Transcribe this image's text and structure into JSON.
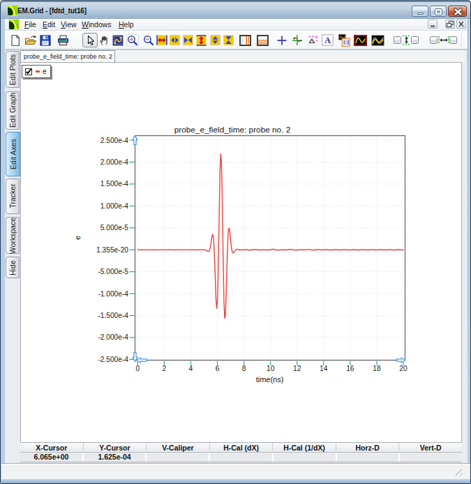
{
  "window": {
    "title": "EM.Grid - [fdtd_tut16]",
    "logo_icon": "emgrid-green-swoosh",
    "controls": [
      "minimize",
      "maximize",
      "close"
    ]
  },
  "menu": {
    "items": [
      {
        "label": "File",
        "accel": "F"
      },
      {
        "label": "Edit",
        "accel": "E"
      },
      {
        "label": "View",
        "accel": "V"
      },
      {
        "label": "Windows",
        "accel": "W"
      },
      {
        "label": "Help",
        "accel": "H"
      }
    ],
    "mdi_controls": [
      "minimize",
      "restore",
      "close"
    ]
  },
  "toolbar": {
    "buttons": [
      {
        "name": "new"
      },
      {
        "name": "open"
      },
      {
        "name": "save"
      },
      {
        "name": "print"
      },
      {
        "name": "select-cursor",
        "active": true
      },
      {
        "name": "pan"
      },
      {
        "name": "fit-to-window"
      },
      {
        "name": "zoom-in"
      },
      {
        "name": "zoom-out"
      },
      {
        "name": "expand-x"
      },
      {
        "name": "stretch-x"
      },
      {
        "name": "compress-x"
      },
      {
        "name": "expand-y"
      },
      {
        "name": "stretch-y"
      },
      {
        "name": "compress-y"
      },
      {
        "name": "vertical-caliper"
      },
      {
        "name": "horizontal-caliper"
      },
      {
        "name": "crosshair-cursor"
      },
      {
        "name": "tracker"
      },
      {
        "name": "slope-caliper"
      },
      {
        "name": "add-text"
      },
      {
        "name": "copy-plot-data"
      },
      {
        "name": "plot-style-boxed"
      },
      {
        "name": "plot-style-plain"
      },
      {
        "name": "sync-y-box-left"
      },
      {
        "name": "sync-y-axes"
      },
      {
        "name": "sync-y-box-right"
      },
      {
        "name": "sync-x-box-left"
      },
      {
        "name": "sync-x-axes"
      },
      {
        "name": "sync-x-box-right"
      }
    ]
  },
  "document_tab": {
    "label": "probe_e_field_time: probe no. 2"
  },
  "sidebar": {
    "tabs": [
      {
        "label": "Edit Plots"
      },
      {
        "label": "Edit Graph"
      },
      {
        "label": "Edit Axes",
        "active": true
      },
      {
        "label": "Tracker"
      },
      {
        "label": "Workspace"
      },
      {
        "label": "Hide"
      }
    ]
  },
  "legend": {
    "series_label": "e",
    "checked": true,
    "line_color": "#f13f3b"
  },
  "chart_data": {
    "type": "line",
    "title": "probe_e_field_time: probe no. 2",
    "xlabel": "time(ns)",
    "ylabel": "e",
    "xlim": [
      0,
      20
    ],
    "ylim": [
      -0.00025,
      0.00025
    ],
    "grid": true,
    "legend_position": "top-left",
    "xticks": [
      0,
      2,
      4,
      6,
      8,
      10,
      12,
      14,
      16,
      18,
      20
    ],
    "yticks": [
      {
        "label": "2.500e-4",
        "value": 0.00025
      },
      {
        "label": "2.000e-4",
        "value": 0.0002
      },
      {
        "label": "1.500e-4",
        "value": 0.00015
      },
      {
        "label": "1.000e-4",
        "value": 0.0001
      },
      {
        "label": "5.000e-5",
        "value": 5e-05
      },
      {
        "label": "1.355e-20",
        "value": 1.355e-20
      },
      {
        "label": "-5.000e-5",
        "value": -5e-05
      },
      {
        "label": "-1.000e-4",
        "value": -0.0001
      },
      {
        "label": "-1.500e-4",
        "value": -0.00015
      },
      {
        "label": "-2.000e-4",
        "value": -0.0002
      },
      {
        "label": "-2.500e-4",
        "value": -0.00025
      }
    ],
    "y_scale": 0.0001,
    "y_unit_note": "series y values are in units of y_scale (1e-4)",
    "series": [
      {
        "name": "e",
        "color": "#f13f3b",
        "x": [
          0.0,
          0.05,
          0.1,
          0.15,
          0.2,
          0.25,
          0.3,
          0.35,
          0.4,
          0.45,
          0.5,
          0.55,
          0.6,
          0.65,
          0.7,
          0.75,
          0.8,
          0.85,
          0.9,
          0.95,
          1.0,
          1.05,
          1.1,
          1.15,
          1.2,
          1.25,
          1.3,
          1.35,
          1.4,
          1.45,
          1.5,
          1.55,
          1.6,
          1.65,
          1.7,
          1.75,
          1.8,
          1.85,
          1.9,
          1.95,
          2.0,
          2.05,
          2.1,
          2.15,
          2.2,
          2.25,
          2.3,
          2.35,
          2.4,
          2.45,
          2.5,
          2.55,
          2.6,
          2.65,
          2.7,
          2.75,
          2.8,
          2.85,
          2.9,
          2.95,
          3.0,
          3.05,
          3.1,
          3.15,
          3.2,
          3.25,
          3.3,
          3.35,
          3.4,
          3.45,
          3.5,
          3.55,
          3.6,
          3.65,
          3.7,
          3.75,
          3.8,
          3.85,
          3.9,
          3.95,
          4.0,
          4.05,
          4.1,
          4.15,
          4.2,
          4.25,
          4.3,
          4.35,
          4.4,
          4.45,
          4.5,
          4.55,
          4.6,
          4.65,
          4.7,
          4.75,
          4.8,
          4.85,
          4.9,
          4.95,
          5.0,
          5.05,
          5.1,
          5.15,
          5.2,
          5.25,
          5.3,
          5.35,
          5.4,
          5.45,
          5.5,
          5.55,
          5.6,
          5.65,
          5.7,
          5.75,
          5.8,
          5.85,
          5.9,
          5.95,
          6.0,
          6.05,
          6.1,
          6.15,
          6.2,
          6.25,
          6.3,
          6.35,
          6.4,
          6.45,
          6.5,
          6.55,
          6.6,
          6.65,
          6.7,
          6.75,
          6.8,
          6.85,
          6.9,
          6.95,
          7.0,
          7.05,
          7.1,
          7.15,
          7.2,
          7.25,
          7.3,
          7.35,
          7.4,
          7.45,
          7.5,
          7.55,
          7.6,
          7.65,
          7.7,
          7.75,
          7.8,
          7.85,
          7.9,
          7.95,
          8.0,
          8.05,
          8.1,
          8.15,
          8.2,
          8.25,
          8.3,
          8.35,
          8.4,
          8.45,
          8.5,
          8.55,
          8.6,
          8.65,
          8.7,
          8.75,
          8.8,
          8.85,
          8.9,
          8.95,
          9.0,
          9.05,
          9.1,
          9.15,
          9.2,
          9.25,
          9.3,
          9.35,
          9.4,
          9.45,
          9.5,
          9.55,
          9.6,
          9.65,
          9.7,
          9.75,
          9.8,
          9.85,
          9.9,
          9.95,
          10.0,
          10.05,
          10.1,
          10.15,
          10.2,
          10.25,
          10.3,
          10.35,
          10.4,
          10.45,
          10.5,
          10.55,
          10.6,
          10.65,
          10.7,
          10.75,
          10.8,
          10.85,
          10.9,
          10.95,
          11.0,
          11.05,
          11.1,
          11.15,
          11.2,
          11.25,
          11.3,
          11.35,
          11.4,
          11.45,
          11.5,
          11.55,
          11.6,
          11.65,
          11.7,
          11.75,
          11.8,
          11.85,
          11.9,
          11.95,
          12.0,
          12.05,
          12.1,
          12.15,
          12.2,
          12.25,
          12.3,
          12.35,
          12.4,
          12.45,
          12.5,
          12.55,
          12.6,
          12.65,
          12.7,
          12.75,
          12.8,
          12.85,
          12.9,
          12.95,
          13.0,
          13.05,
          13.1,
          13.15,
          13.2,
          13.25,
          13.3,
          13.35,
          13.4,
          13.45,
          13.5,
          13.55,
          13.6,
          13.65,
          13.7,
          13.75,
          13.8,
          13.85,
          13.9,
          13.95,
          14.0,
          14.05,
          14.1,
          14.15,
          14.2,
          14.25,
          14.3,
          14.35,
          14.4,
          14.45,
          14.5,
          14.55,
          14.6,
          14.65,
          14.7,
          14.75,
          14.8,
          14.85,
          14.9,
          14.95,
          15.0,
          15.05,
          15.1,
          15.15,
          15.2,
          15.25,
          15.3,
          15.35,
          15.4,
          15.45,
          15.5,
          15.55,
          15.6,
          15.65,
          15.7,
          15.75,
          15.8,
          15.85,
          15.9,
          15.95,
          16.0,
          16.05,
          16.1,
          16.15,
          16.2,
          16.25,
          16.3,
          16.35,
          16.4,
          16.45,
          16.5,
          16.55,
          16.6,
          16.65,
          16.7,
          16.75,
          16.8,
          16.85,
          16.9,
          16.95,
          17.0,
          17.05,
          17.1,
          17.15,
          17.2,
          17.25,
          17.3,
          17.35,
          17.4,
          17.45,
          17.5,
          17.55,
          17.6,
          17.65,
          17.7,
          17.75,
          17.8,
          17.85,
          17.9,
          17.95,
          18.0,
          18.05,
          18.1,
          18.15,
          18.2,
          18.25,
          18.3,
          18.35,
          18.4,
          18.45,
          18.5,
          18.55,
          18.6,
          18.65,
          18.7,
          18.75,
          18.8,
          18.85,
          18.9,
          18.95,
          19.0,
          19.05,
          19.1,
          19.15,
          19.2,
          19.25,
          19.3,
          19.35,
          19.4,
          19.45,
          19.5,
          19.55,
          19.6,
          19.65,
          19.7,
          19.75,
          19.8,
          19.85,
          19.9,
          19.95,
          20.0
        ],
        "y": [
          0.0,
          0.003,
          0.0007,
          0.0007,
          0.0034,
          0.0011,
          -0.0023,
          -0.0006,
          -0.0003,
          -0.0036,
          -0.0021,
          0.0015,
          0.0002,
          -0.0002,
          0.0034,
          0.0028,
          -0.0008,
          0.0002,
          0.001,
          -0.0028,
          -0.0033,
          0.0001,
          -0.0006,
          -0.0018,
          0.002,
          0.0034,
          0.0003,
          0.0009,
          0.0026,
          -0.001,
          -0.0032,
          -0.0005,
          -0.001,
          -0.0032,
          -0.0002,
          0.0027,
          0.0005,
          0.0008,
          0.0036,
          0.0012,
          -0.002,
          -0.0002,
          -0.0003,
          -0.0037,
          -0.0022,
          0.0013,
          -0.0002,
          -0.0004,
          0.0034,
          0.0028,
          -0.0006,
          0.0006,
          0.0012,
          -0.0028,
          -0.0032,
          0.0,
          -0.001,
          -0.0021,
          0.0019,
          0.0032,
          0.0003,
          0.0012,
          0.0029,
          -0.0008,
          -0.0029,
          -0.0003,
          -0.0012,
          -0.0035,
          -0.0003,
          0.0023,
          0.0002,
          0.0008,
          0.0038,
          0.0014,
          -0.0017,
          0.0002,
          -0.0002,
          -0.0038,
          -0.0022,
          0.001,
          -0.0006,
          -0.0005,
          0.0034,
          0.0027,
          -0.0004,
          0.0011,
          0.0015,
          -0.0027,
          -0.003,
          0.0,
          -0.0014,
          -0.0024,
          0.0017,
          0.0029,
          0.0001,
          0.0015,
          0.0032,
          -0.0003,
          -0.0017,
          0.0013,
          0.0006,
          -0.0009,
          -0.0033,
          -0.0083,
          -0.0164,
          -0.0272,
          -0.0369,
          -0.038,
          -0.0195,
          0.029,
          0.1112,
          0.2164,
          0.3139,
          0.3547,
          0.2837,
          0.063,
          -0.3023,
          -0.7456,
          -1.1414,
          -1.3358,
          -1.2005,
          -0.6901,
          0.1192,
          1.0352,
          1.8018,
          2.1843,
          2.0546,
          1.441,
          0.5204,
          -0.444,
          -1.1946,
          -1.5632,
          -1.5148,
          -1.14,
          -0.6045,
          -0.083,
          0.2971,
          0.4828,
          0.4907,
          0.3813,
          0.2266,
          0.0842,
          -0.0143,
          -0.0627,
          -0.0713,
          -0.0569,
          -0.0348,
          -0.0149,
          -0.0015,
          0.0056,
          0.0107,
          0.008,
          -0.0016,
          0.003,
          0.0057,
          -0.0033,
          -0.0034,
          -0.0022,
          -0.0067,
          0.0009,
          0.0075,
          -0.0004,
          -0.0005,
          0.0039,
          -0.0006,
          0.0018,
          0.0044,
          -0.007,
          -0.0098,
          -0.0029,
          -0.0053,
          -0.0037,
          0.0021,
          -0.0037,
          -0.0025,
          0.0092,
          0.0083,
          0.0054,
          0.0083,
          0.0013,
          -0.0017,
          0.0063,
          0.0018,
          -0.006,
          -0.0026,
          -0.0045,
          -0.0052,
          0.0046,
          0.0026,
          -0.0054,
          -0.0003,
          0.0006,
          -0.0032,
          0.0017,
          -0.0021,
          -0.0117,
          -0.0056,
          -0.0004,
          -0.0032,
          0.0024,
          0.004,
          -0.0012,
          0.0073,
          0.0143,
          0.0075,
          0.0068,
          0.0059,
          -0.0027,
          0.0004,
          0.004,
          -0.0064,
          -0.0088,
          -0.0046,
          -0.0078,
          -0.0029,
          0.0039,
          -0.004,
          -0.0057,
          0.0017,
          -0.0009,
          -0.001,
          0.0027,
          -0.0057,
          -0.0079,
          0.0025,
          0.0025,
          0.0014,
          0.0072,
          0.0035,
          0.0027,
          0.0131,
          0.0108,
          0.0024,
          0.0035,
          -0.0017,
          -0.0068,
          -0.0001,
          -0.0035,
          -0.0127,
          -0.0079,
          -0.0049,
          -0.0058,
          0.003,
          0.0032,
          -0.0049,
          0.0008,
          0.0053,
          0.0005,
          0.003,
          0.0016,
          -0.0072,
          -0.0014,
          0.0059,
          0.0011,
          0.0029,
          0.0055,
          -0.0001,
          0.0051,
          0.0114,
          0.0019,
          -0.0024,
          -0.0009,
          -0.0073,
          -0.0056,
          -0.0001,
          -0.0084,
          -0.0106,
          -0.0018,
          -0.0015,
          0.0013,
          0.0082,
          0.0015,
          -0.0019,
          0.0066,
          0.0045,
          -0.0001,
          0.0024,
          -0.0042,
          -0.0078,
          0.0026,
          0.0031,
          -0.0019,
          0.0028,
          0.0016,
          -0.0007,
          0.0082,
          0.0065,
          -0.004,
          -0.0025,
          -0.0028,
          -0.0071,
          -0.0007,
          -0.001,
          -0.0096,
          -0.0036,
          0.0033,
          0.0014,
          0.0065,
          0.0071,
          -0.0021,
          0.0014,
          0.0069,
          -0.0004,
          -0.0019,
          -0.0016,
          -0.009,
          -0.0042,
          0.0048,
          -0.0006,
          -0.0015,
          0.0037,
          0.0002,
          0.0031,
          0.0096,
          0.0004,
          -0.0056,
          -0.0009,
          -0.0041,
          -0.0043,
          0.0018,
          -0.0046,
          -0.0076,
          0.003,
          0.0046,
          0.0029,
          0.0077,
          0.0019,
          -0.0035,
          0.0045,
          0.0033,
          -0.0047,
          -0.0026,
          -0.0053,
          -0.0084,
          0.002,
          0.0044,
          -0.0026,
          0.0017,
          0.004,
          0.0008,
          0.0071,
          0.0062,
          -0.0055,
          -0.0043,
          -0.0007,
          -0.0051,
          -0.0012,
          0.0005,
          -0.0074,
          -0.0021,
          0.0071,
          0.0036,
          0.0043,
          0.0057,
          -0.0029,
          -0.0011,
          0.0056,
          -0.0022,
          -0.0062,
          -0.0029,
          -0.007,
          -0.0034,
          0.0064,
          0.0013,
          -0.0021,
          0.0048,
          0.0031,
          0.0026,
          0.0078,
          -0.0008,
          -0.0082,
          -0.0016,
          -0.002,
          -0.0046,
          0.001,
          -0.0027,
          -0.0062,
          0.0048,
          0.0077,
          0.0022,
          0.005,
          0.0016,
          -0.0045,
          0.0026,
          0.0028,
          -0.007,
          -0.0052,
          -0.0033,
          -0.0058,
          0.0031,
          0.0065,
          -0.0019,
          0.001,
          0.0061,
          0.0018,
          0.0044,
          0.0041,
          -0.0074,
          -0.0065,
          0.0005,
          -0.0036
        ]
      }
    ]
  },
  "cursor_table": {
    "headers": [
      "X-Cursor",
      "Y-Cursor",
      "V-Caliper",
      "H-Cal (dX)",
      "H-Cal (1/dX)",
      "Horz-D",
      "Vert-D"
    ],
    "values": [
      "6.065e+00",
      "1.625e-04",
      "",
      "",
      "",
      "",
      ""
    ]
  },
  "status_bar": {
    "text": ""
  }
}
